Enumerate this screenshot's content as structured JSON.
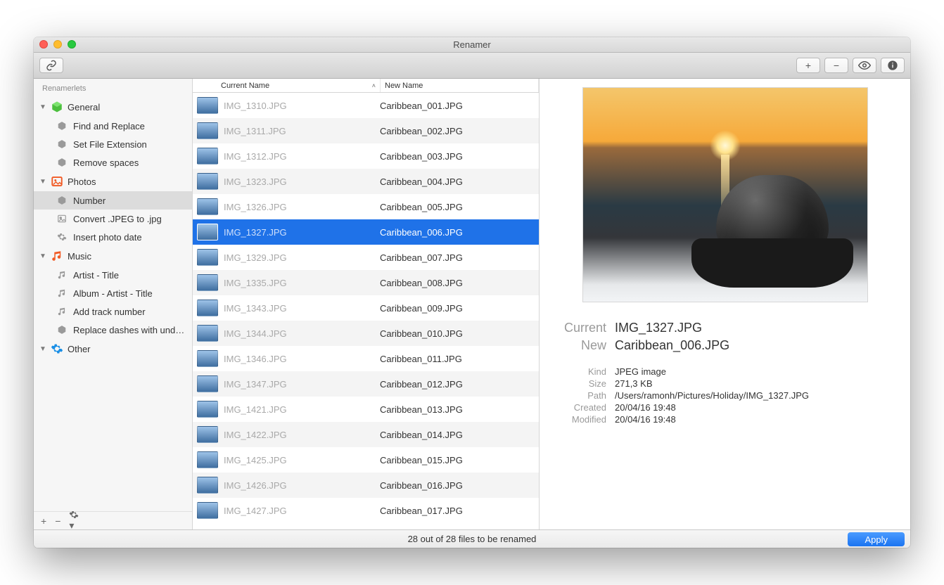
{
  "window": {
    "title": "Renamer"
  },
  "toolbar": {
    "link_icon": "link-icon",
    "add": "+",
    "remove": "−",
    "preview_icon": "eye-icon",
    "info_icon": "info-icon"
  },
  "sidebar": {
    "header": "Renamerlets",
    "groups": [
      {
        "label": "General",
        "icon": "cube-green-icon",
        "items": [
          {
            "label": "Find and Replace",
            "icon": "cube-icon"
          },
          {
            "label": "Set File Extension",
            "icon": "cube-icon"
          },
          {
            "label": "Remove spaces",
            "icon": "cube-icon"
          }
        ]
      },
      {
        "label": "Photos",
        "icon": "image-orange-icon",
        "items": [
          {
            "label": "Number",
            "icon": "cube-icon",
            "selected": true
          },
          {
            "label": "Convert .JPEG to .jpg",
            "icon": "image-icon"
          },
          {
            "label": "Insert photo date",
            "icon": "gear-icon"
          }
        ]
      },
      {
        "label": "Music",
        "icon": "music-orange-icon",
        "items": [
          {
            "label": "Artist - Title",
            "icon": "music-icon"
          },
          {
            "label": "Album - Artist - Title",
            "icon": "music-icon"
          },
          {
            "label": "Add track number",
            "icon": "music-icon"
          },
          {
            "label": "Replace dashes with unde...",
            "icon": "cube-icon"
          }
        ]
      },
      {
        "label": "Other",
        "icon": "gear-blue-icon",
        "items": []
      }
    ],
    "footer": {
      "add": "+",
      "remove": "−",
      "gear": "gear-icon"
    }
  },
  "table": {
    "columns": {
      "current": "Current Name",
      "sort": "˄",
      "new": "New Name"
    },
    "rows": [
      {
        "current": "IMG_1310.JPG",
        "new": "Caribbean_001.JPG"
      },
      {
        "current": "IMG_1311.JPG",
        "new": "Caribbean_002.JPG"
      },
      {
        "current": "IMG_1312.JPG",
        "new": "Caribbean_003.JPG"
      },
      {
        "current": "IMG_1323.JPG",
        "new": "Caribbean_004.JPG"
      },
      {
        "current": "IMG_1326.JPG",
        "new": "Caribbean_005.JPG"
      },
      {
        "current": "IMG_1327.JPG",
        "new": "Caribbean_006.JPG",
        "selected": true
      },
      {
        "current": "IMG_1329.JPG",
        "new": "Caribbean_007.JPG"
      },
      {
        "current": "IMG_1335.JPG",
        "new": "Caribbean_008.JPG"
      },
      {
        "current": "IMG_1343.JPG",
        "new": "Caribbean_009.JPG"
      },
      {
        "current": "IMG_1344.JPG",
        "new": "Caribbean_010.JPG"
      },
      {
        "current": "IMG_1346.JPG",
        "new": "Caribbean_011.JPG"
      },
      {
        "current": "IMG_1347.JPG",
        "new": "Caribbean_012.JPG"
      },
      {
        "current": "IMG_1421.JPG",
        "new": "Caribbean_013.JPG"
      },
      {
        "current": "IMG_1422.JPG",
        "new": "Caribbean_014.JPG"
      },
      {
        "current": "IMG_1425.JPG",
        "new": "Caribbean_015.JPG"
      },
      {
        "current": "IMG_1426.JPG",
        "new": "Caribbean_016.JPG"
      },
      {
        "current": "IMG_1427.JPG",
        "new": "Caribbean_017.JPG"
      }
    ]
  },
  "inspector": {
    "labels": {
      "current": "Current",
      "new": "New",
      "kind": "Kind",
      "size": "Size",
      "path": "Path",
      "created": "Created",
      "modified": "Modified"
    },
    "current": "IMG_1327.JPG",
    "new": "Caribbean_006.JPG",
    "kind": "JPEG image",
    "size": "271,3 KB",
    "path": "/Users/ramonh/Pictures/Holiday/IMG_1327.JPG",
    "created": "20/04/16 19:48",
    "modified": "20/04/16 19:48"
  },
  "status": {
    "text": "28 out of 28 files to be renamed",
    "apply": "Apply"
  }
}
